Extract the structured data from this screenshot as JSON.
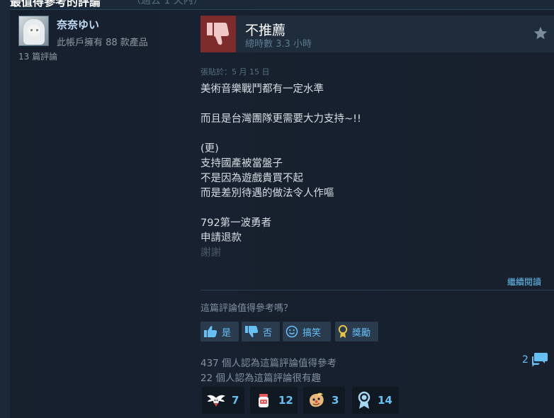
{
  "header": {
    "title": "最值得參考的評論",
    "subtitle": "（過去 1 天內）"
  },
  "user": {
    "name": "奈奈ゆい",
    "products_owned": "此帳戶擁有 88 款產品",
    "review_count": "13 篇評論"
  },
  "review": {
    "verdict": "不推薦",
    "hours": "總時數 3.3 小時",
    "posted": "張貼於：5 月 15 日",
    "lines": [
      "美術音樂戰鬥都有一定水準",
      "",
      "而且是台灣團隊更需要大力支持~!!",
      "",
      "(更)",
      "支持國產被當盤子",
      "不是因為遊戲貴買不起",
      "而是差別待遇的做法令人作嘔",
      "",
      "792第一波勇者",
      "申請退款",
      "謝謝"
    ],
    "read_more": "繼續閱讀"
  },
  "feedback": {
    "question": "這篇評論值得參考嗎？",
    "yes_label": "是",
    "no_label": "否",
    "funny_label": "搞笑",
    "award_label": "獎勵",
    "helpful_count": "437 個人認為這篇評論值得參考",
    "funny_count": "22 個人認為這篇評論很有趣",
    "comment_count": "2"
  },
  "awards": [
    {
      "icon": "wings-award-icon",
      "count": "7"
    },
    {
      "icon": "jar-award-icon",
      "count": "12"
    },
    {
      "icon": "clown-award-icon",
      "count": "3"
    },
    {
      "icon": "medal-award-icon",
      "count": "14"
    }
  ],
  "colors": {
    "background": "#1b2838",
    "accent": "#66c0f4",
    "negative": "#7d2b2b"
  }
}
